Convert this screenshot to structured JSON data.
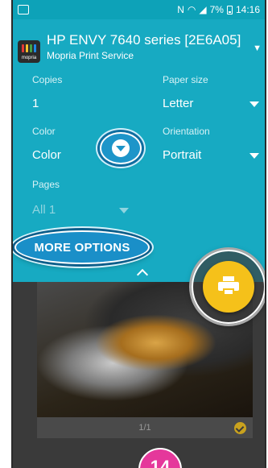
{
  "status_bar": {
    "signal_text": "N",
    "battery": "7%",
    "time": "14:16"
  },
  "printer": {
    "name": "HP ENVY 7640 series [2E6A05]",
    "service": "Mopria Print Service",
    "logo_text": "mopria",
    "logo_colors": [
      "#e53935",
      "#fbc02d",
      "#43a047",
      "#1e88e5"
    ]
  },
  "fields": {
    "copies": {
      "label": "Copies",
      "value": "1"
    },
    "paper_size": {
      "label": "Paper size",
      "value": "Letter"
    },
    "color": {
      "label": "Color",
      "value": "Color"
    },
    "orientation": {
      "label": "Orientation",
      "value": "Portrait"
    },
    "pages": {
      "label": "Pages",
      "value": "All 1"
    }
  },
  "more_options_label": "MORE OPTIONS",
  "preview": {
    "page_indicator": "1/1"
  },
  "step_badge": "14",
  "colors": {
    "accent": "#17aac2",
    "fab": "#f5c11a",
    "badge": "#e5389b"
  },
  "icons": {
    "fab": "printer-icon",
    "collapse": "chevron-up-icon",
    "selected": "check-circle-icon"
  }
}
